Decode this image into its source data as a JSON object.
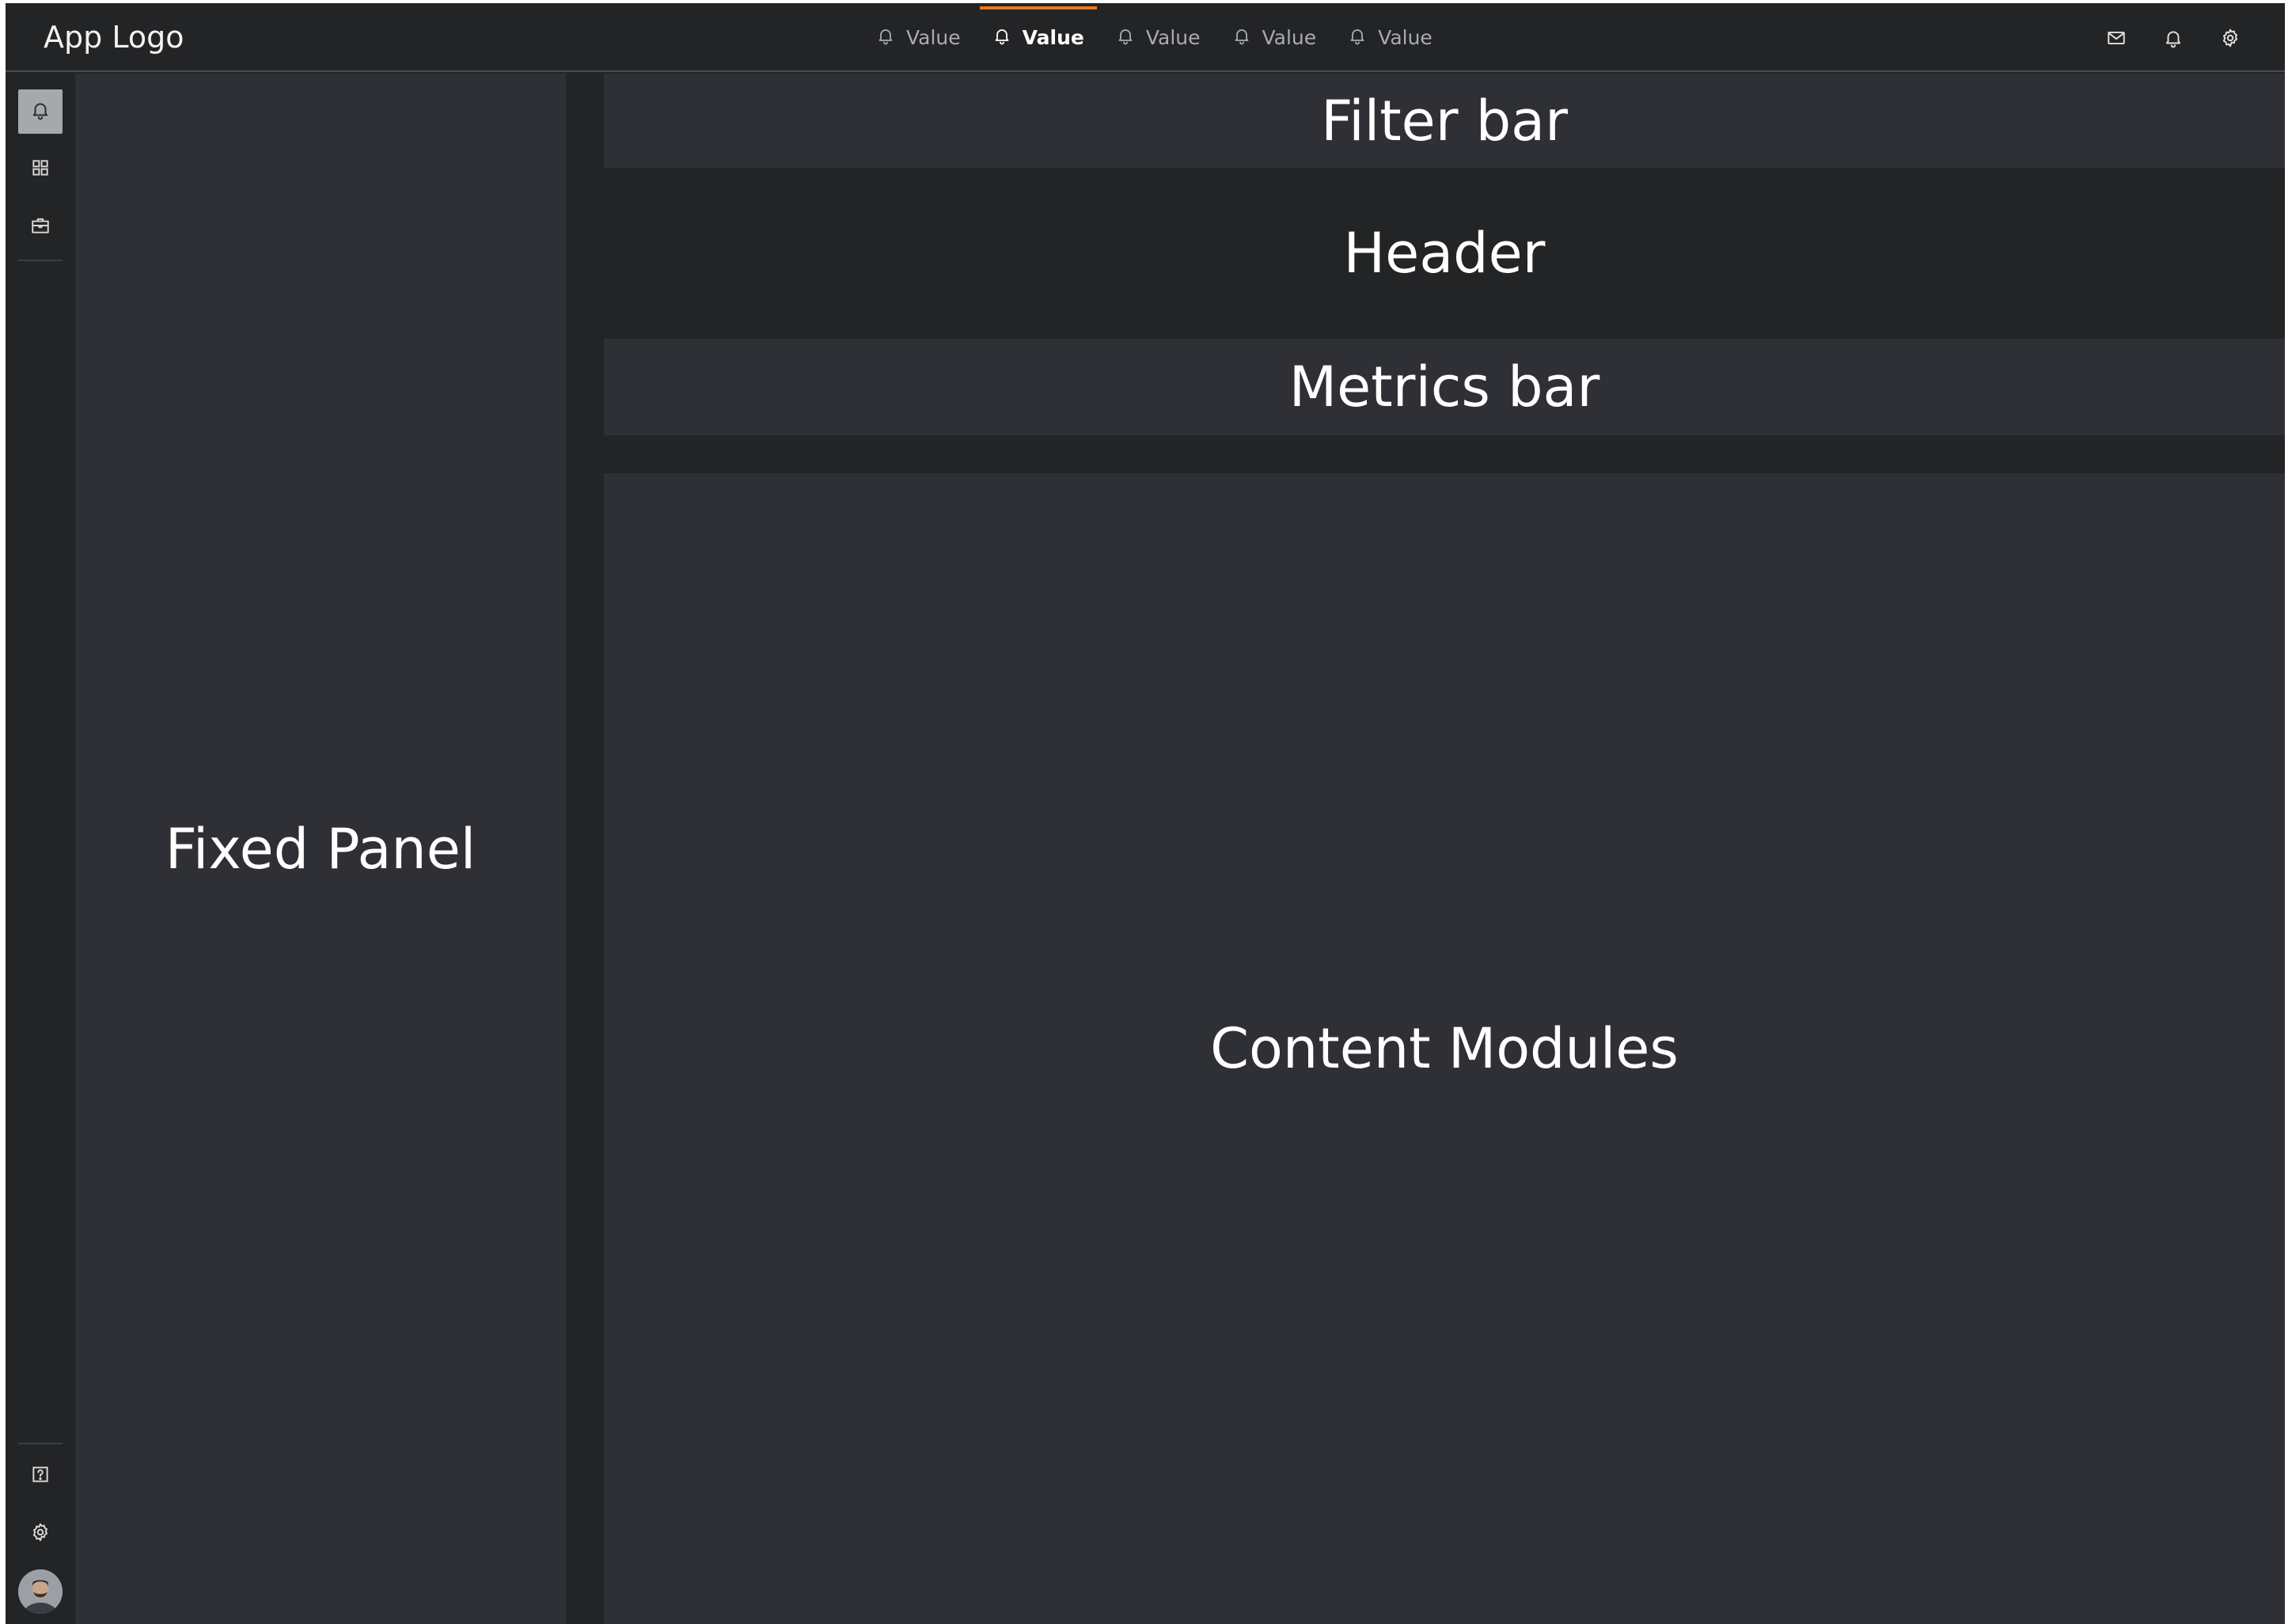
{
  "app": {
    "logo_text": "App Logo"
  },
  "topbar": {
    "tabs": [
      {
        "label": "Value",
        "icon": "bell-icon",
        "active": false
      },
      {
        "label": "Value",
        "icon": "bell-icon",
        "active": true
      },
      {
        "label": "Value",
        "icon": "bell-icon",
        "active": false
      },
      {
        "label": "Value",
        "icon": "bell-icon",
        "active": false
      },
      {
        "label": "Value",
        "icon": "bell-icon",
        "active": false
      }
    ],
    "actions": [
      "mail-icon",
      "bell-icon",
      "gear-icon"
    ]
  },
  "rail": {
    "top_items": [
      "bell-icon",
      "grid-icon",
      "briefcase-icon"
    ],
    "bottom_items": [
      "help-icon",
      "gear-icon",
      "user-avatar"
    ],
    "active_item": "bell-icon"
  },
  "panels": {
    "fixed_panel": "Fixed Panel",
    "filter_bar": "Filter bar",
    "header": "Header",
    "metrics_bar": "Metrics bar",
    "content_modules": "Content Modules"
  },
  "colors": {
    "background": "#232426",
    "panel": "#2f3035",
    "accent": "#e8781e",
    "text": "#ffffff",
    "muted_text": "#a9abb0",
    "active_rail_bg": "#a6a8ad"
  }
}
